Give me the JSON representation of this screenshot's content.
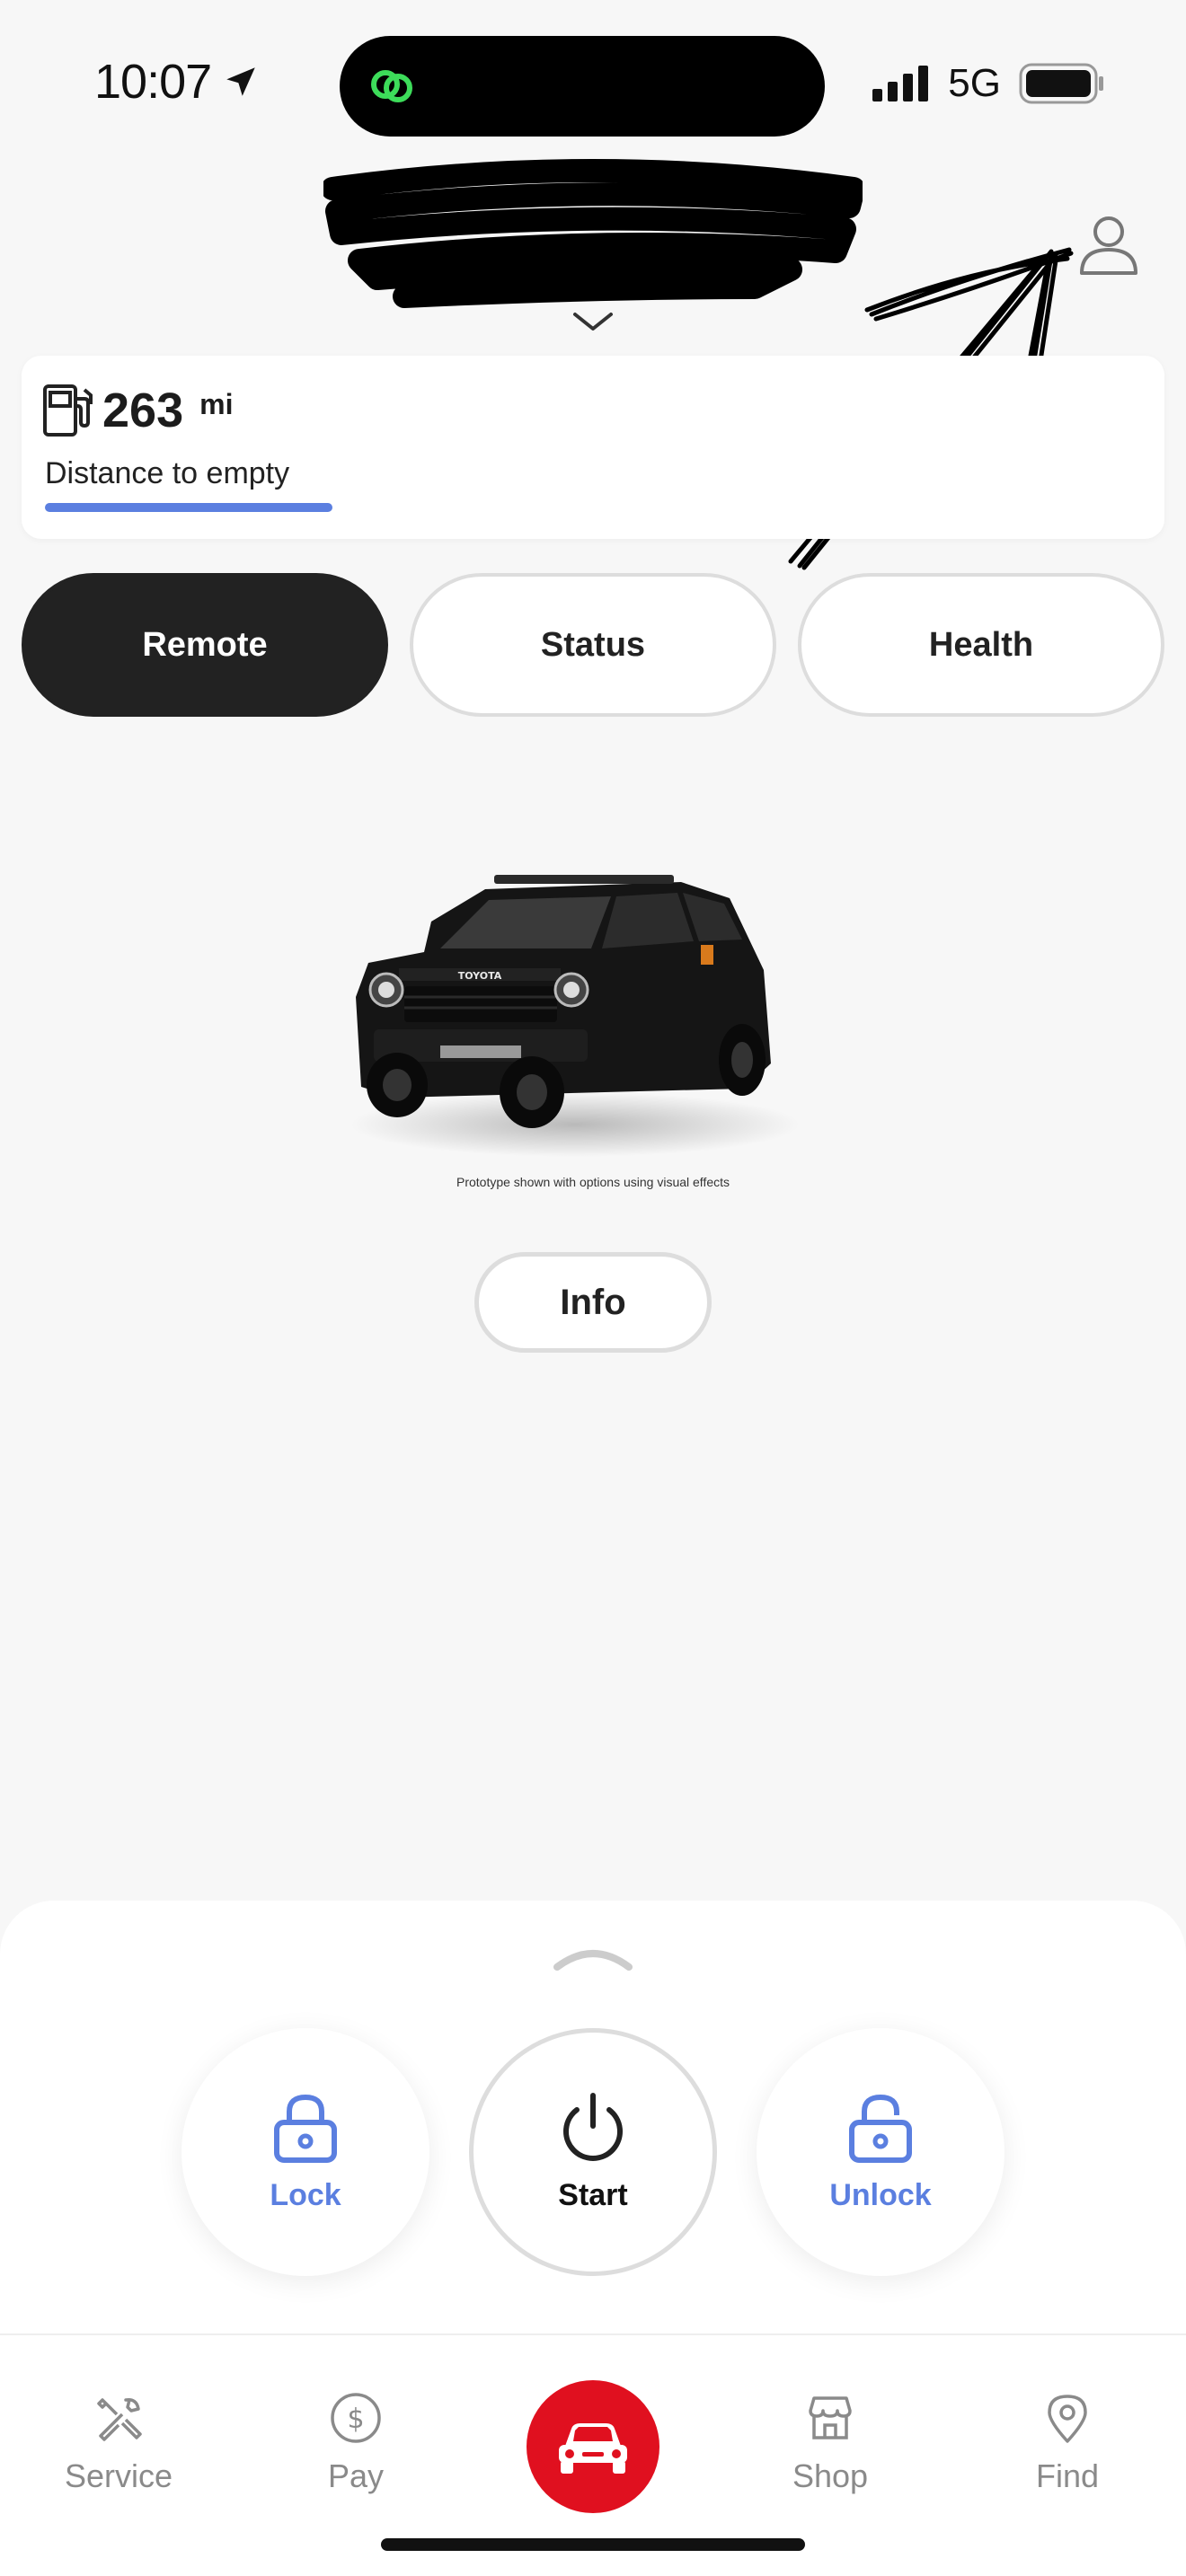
{
  "status_bar": {
    "time": "10:07",
    "network": "5G",
    "icons": [
      "location-arrow-icon",
      "link-app-icon",
      "signal-bars-icon",
      "battery-icon"
    ]
  },
  "header": {
    "icons": [
      "chevron-down-icon",
      "profile-icon"
    ]
  },
  "fuel": {
    "value": "263",
    "unit": "mi",
    "label": "Distance to empty",
    "accent_color": "#5b7fe0"
  },
  "tabs": [
    {
      "label": "Remote",
      "active": true
    },
    {
      "label": "Status",
      "active": false
    },
    {
      "label": "Health",
      "active": false
    }
  ],
  "vehicle": {
    "badge": "TOYOTA",
    "disclaimer": "Prototype shown with options using visual effects",
    "info_label": "Info"
  },
  "actions": {
    "lock": "Lock",
    "start": "Start",
    "unlock": "Unlock",
    "accent_color": "#5b7fe0"
  },
  "nav": {
    "service": "Service",
    "pay": "Pay",
    "shop": "Shop",
    "find": "Find",
    "center_color": "#e0101f"
  }
}
